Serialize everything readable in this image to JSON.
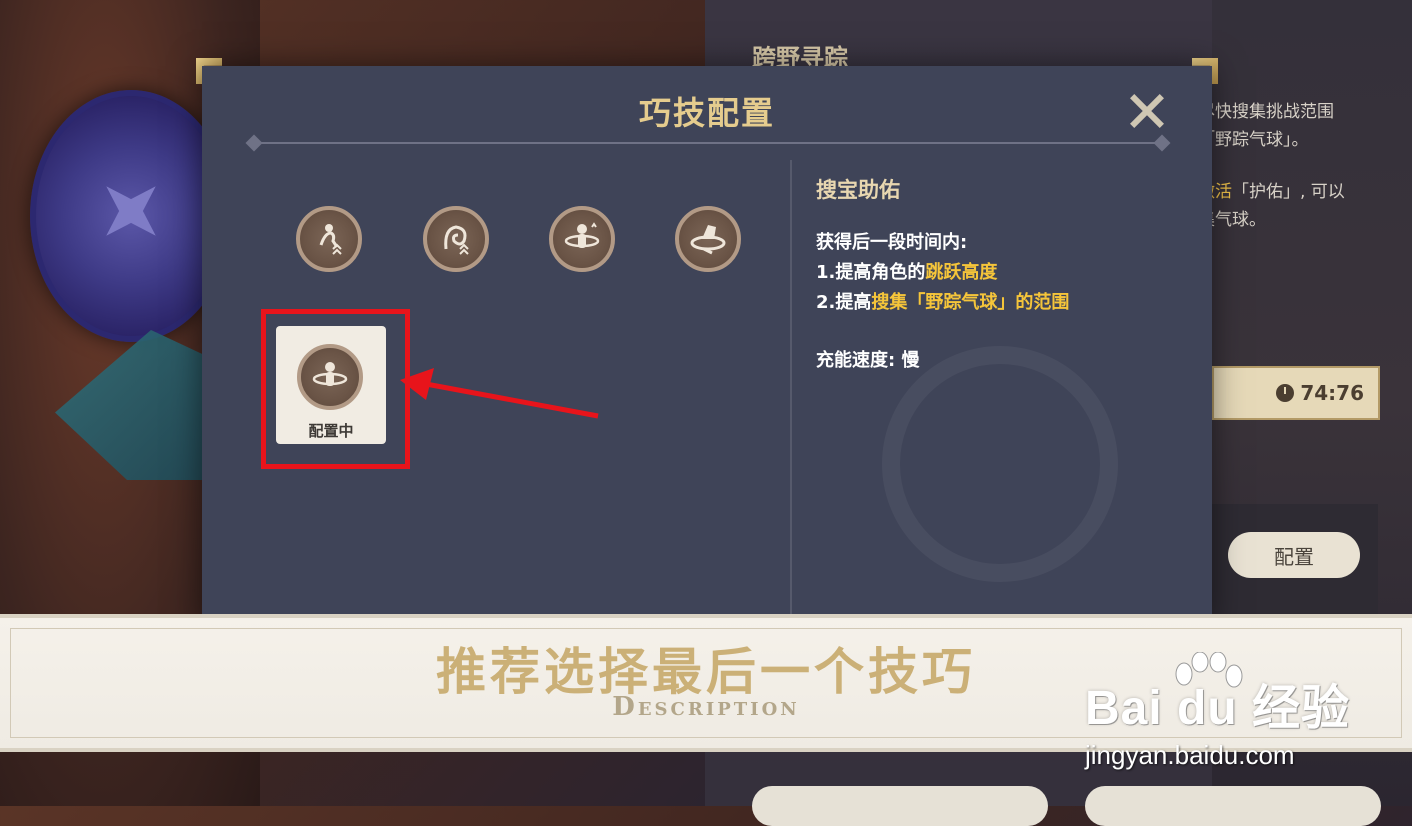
{
  "background": {
    "right_panel_title": "跨野寻踪",
    "right_panel_text_1": "尽快搜集挑战范围\n「野踪气球」。",
    "right_panel_text_2_highlight": "激活",
    "right_panel_text_2_rest": "「护佑」, 可以\n集气球。",
    "timer": "74:76",
    "config_button": "配置"
  },
  "modal": {
    "title": "巧技配置",
    "skills": [
      {
        "icon": "jump-up-icon"
      },
      {
        "icon": "swirl-up-icon"
      },
      {
        "icon": "figure-ring-icon"
      },
      {
        "icon": "hat-ring-icon"
      }
    ],
    "selected_skill": {
      "icon": "figure-ring-icon",
      "label": "配置中"
    },
    "description": {
      "title": "搜宝助佑",
      "intro": "获得后一段时间内:",
      "line1_prefix": "1.提高角色的",
      "line1_highlight": "跳跃高度",
      "line2_prefix": "2.提高",
      "line2_highlight": "搜集「野踪气球」的范围",
      "charge": "充能速度: 慢"
    }
  },
  "caption": {
    "main": "推荐选择最后一个技巧",
    "sub": "Description"
  },
  "watermark": {
    "logo": "Bai du 经验",
    "url": "jingyan.baidu.com"
  },
  "colors": {
    "accent_gold": "#e5cc8e",
    "highlight_yellow": "#f5c53a",
    "annotation_red": "#e8141b",
    "modal_bg": "#3f4458"
  }
}
